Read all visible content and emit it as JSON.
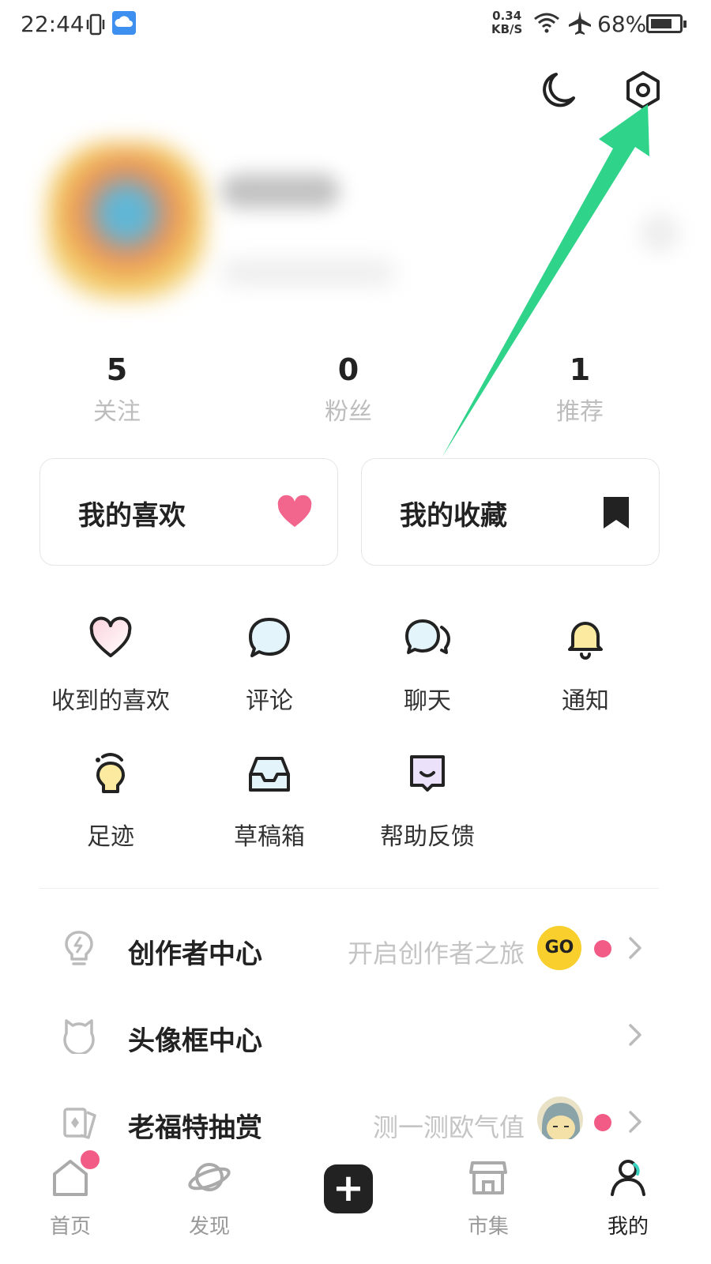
{
  "status_bar": {
    "time": "22:44",
    "speed_value": "0.34",
    "speed_unit": "KB/S",
    "battery": "68%"
  },
  "top_icons": {
    "moon": "moon-icon",
    "settings": "settings-icon"
  },
  "stats": [
    {
      "value": "5",
      "label": "关注"
    },
    {
      "value": "0",
      "label": "粉丝"
    },
    {
      "value": "1",
      "label": "推荐"
    }
  ],
  "cards": [
    {
      "label": "我的喜欢",
      "icon": "heart-icon",
      "icon_color": "#f2668d"
    },
    {
      "label": "我的收藏",
      "icon": "bookmark-icon",
      "icon_color": "#222222"
    }
  ],
  "grid": [
    {
      "label": "收到的喜欢",
      "icon": "heart-outline-icon"
    },
    {
      "label": "评论",
      "icon": "comment-icon"
    },
    {
      "label": "聊天",
      "icon": "chat-icon"
    },
    {
      "label": "通知",
      "icon": "bell-icon"
    },
    {
      "label": "足迹",
      "icon": "lightbulb-icon"
    },
    {
      "label": "草稿箱",
      "icon": "inbox-icon"
    },
    {
      "label": "帮助反馈",
      "icon": "feedback-icon"
    }
  ],
  "list": [
    {
      "title": "创作者中心",
      "subtitle": "开启创作者之旅",
      "badge": "GO",
      "icon": "bulb-icon"
    },
    {
      "title": "头像框中心",
      "subtitle": "",
      "icon": "cat-frame-icon"
    },
    {
      "title": "老福特抽赏",
      "subtitle": "测一测欧气值",
      "icon": "card-icon"
    }
  ],
  "nav": [
    {
      "label": "首页",
      "icon": "home-icon"
    },
    {
      "label": "发现",
      "icon": "planet-icon"
    },
    {
      "label": "",
      "icon": "plus-icon"
    },
    {
      "label": "市集",
      "icon": "shop-icon"
    },
    {
      "label": "我的",
      "icon": "profile-icon"
    }
  ],
  "colors": {
    "accent_pink": "#f25b86",
    "arrow_green": "#2fd38a",
    "badge_yellow": "#f8cf2c"
  }
}
